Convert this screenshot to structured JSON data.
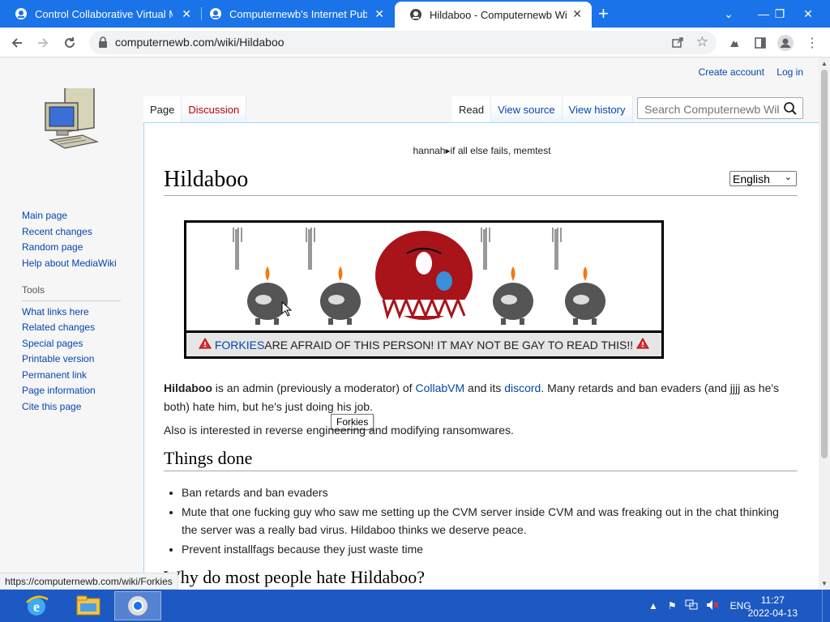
{
  "browser": {
    "tabs": [
      {
        "title": "Control Collaborative Virtual Ma",
        "active": false
      },
      {
        "title": "Computernewb's Internet Pub Hu",
        "active": false
      },
      {
        "title": "Hildaboo - Computernewb Wiki",
        "active": true
      }
    ],
    "url": "computernewb.com/wiki/Hildaboo",
    "status_url": "https://computernewb.com/wiki/Forkies"
  },
  "personal": {
    "create_account": "Create account",
    "log_in": "Log in"
  },
  "sidebar": {
    "nav": [
      "Main page",
      "Recent changes",
      "Random page",
      "Help about MediaWiki"
    ],
    "tools_heading": "Tools",
    "tools": [
      "What links here",
      "Related changes",
      "Special pages",
      "Printable version",
      "Permanent link",
      "Page information",
      "Cite this page"
    ]
  },
  "wiki_tabs": {
    "page": "Page",
    "discussion": "Discussion",
    "read": "Read",
    "view_source": "View source",
    "view_history": "View history"
  },
  "search": {
    "placeholder": "Search Computernewb Wiki"
  },
  "sitenotice": "hannah▸if all else fails, memtest",
  "title": "Hildaboo",
  "language": "English",
  "banner": {
    "link": "FORKIES",
    "text": " ARE AFRAID OF THIS PERSON! IT MAY NOT BE GAY TO READ THIS!!",
    "tooltip": "Forkies"
  },
  "intro": {
    "bold": "Hildaboo",
    "t1": " is an admin (previously a moderator) of ",
    "link1": "CollabVM",
    "t2": " and its ",
    "link2": "discord",
    "t3": ". Many retards and ban evaders (and jjjj as he's both) hate him, but he's just doing his job."
  },
  "intro2": "Also is interested in reverse engineering and modifying ransomwares.",
  "section1": {
    "heading": "Things done",
    "items": [
      "Ban retards and ban evaders",
      "Mute that one fucking guy who saw me setting up the CVM server inside CVM and was freaking out in the chat thinking the server was a really bad virus. Hildaboo thinks we deserve peace.",
      "Prevent installfags because they just waste time"
    ]
  },
  "section2": {
    "heading": "Why do most people hate Hildaboo?"
  },
  "taskbar": {
    "language": "ENG",
    "time": "11:27",
    "date": "2022-04-13"
  }
}
